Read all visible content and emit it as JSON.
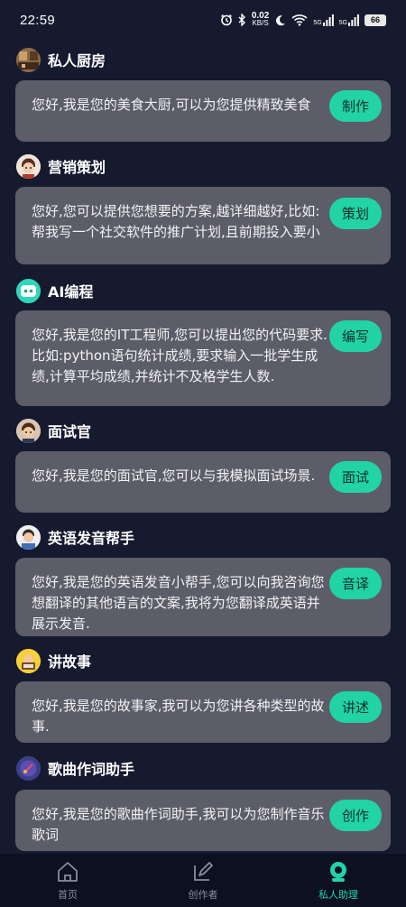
{
  "status_bar": {
    "time": "22:59",
    "net_speed_value": "0.02",
    "net_speed_unit": "KB/S",
    "signal_1": "5G",
    "signal_2": "5G",
    "battery": "66"
  },
  "assistants": [
    {
      "title": "私人厨房",
      "description": "您好,我是您的美食大厨,可以为您提供精致美食",
      "action": "制作",
      "avatar_icon": "kitchen-avatar-icon"
    },
    {
      "title": "营销策划",
      "description": "您好,您可以提供您想要的方案,越详细越好,比如:帮我写一个社交软件的推广计划,且前期投入要小",
      "action": "策划",
      "avatar_icon": "marketing-avatar-icon"
    },
    {
      "title": "AI编程",
      "description": "您好,我是您的IT工程师,您可以提出您的代码要求.比如:python语句统计成绩,要求输入一批学生成绩,计算平均成绩,并统计不及格学生人数.",
      "action": "编写",
      "avatar_icon": "robot-avatar-icon"
    },
    {
      "title": "面试官",
      "description": "您好,我是您的面试官,您可以与我模拟面试场景.",
      "action": "面试",
      "avatar_icon": "interviewer-avatar-icon"
    },
    {
      "title": "英语发音帮手",
      "description": "您好,我是您的英语发音小帮手,您可以向我咨询您想翻译的其他语言的文案,我将为您翻译成英语并展示发音.",
      "action": "音译",
      "avatar_icon": "english-avatar-icon"
    },
    {
      "title": "讲故事",
      "description": "您好,我是您的故事家,我可以为您讲各种类型的故事.",
      "action": "讲述",
      "avatar_icon": "storyteller-avatar-icon"
    },
    {
      "title": "歌曲作词助手",
      "description": "您好,我是您的歌曲作词助手,我可以为您制作音乐歌词",
      "action": "创作",
      "avatar_icon": "lyrics-avatar-icon"
    }
  ],
  "bottom_nav": {
    "items": [
      {
        "label": "首页",
        "icon": "home-icon",
        "active": false
      },
      {
        "label": "创作者",
        "icon": "edit-icon",
        "active": false
      },
      {
        "label": "私人助理",
        "icon": "assistant-icon",
        "active": true
      }
    ]
  },
  "colors": {
    "background": "#161a2e",
    "card": "#5c5d69",
    "accent": "#22d3a5",
    "nav_background": "#0d1020"
  }
}
